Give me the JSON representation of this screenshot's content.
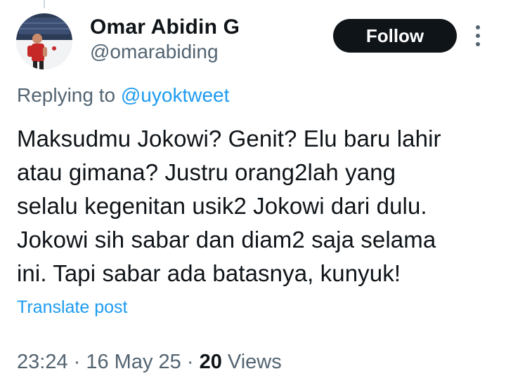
{
  "author": {
    "display_name": "Omar Abidin G",
    "handle": "@omarabiding"
  },
  "follow_button": {
    "label": "Follow"
  },
  "more_menu": {
    "icon": "more-vertical-icon"
  },
  "reply_context": {
    "prefix": "Replying to ",
    "mention": "@uyoktweet"
  },
  "tweet": {
    "lines": [
      "Maksudmu Jokowi? Genit? Elu baru lahir",
      "atau gimana? Justru orang2lah yang",
      "selalu kegenitan usik2 Jokowi dari dulu.",
      "Jokowi sih sabar dan diam2 saja selama",
      "ini. Tapi sabar ada batasnya, kunyuk!"
    ],
    "translate_label": "Translate post"
  },
  "meta": {
    "time": "23:24",
    "separator": " · ",
    "date": "16 May 25",
    "views_count": "20",
    "views_label": " Views"
  },
  "colors": {
    "text": "#0f1419",
    "secondary": "#536471",
    "link": "#1d9bf0",
    "button_bg": "#0f1419"
  }
}
